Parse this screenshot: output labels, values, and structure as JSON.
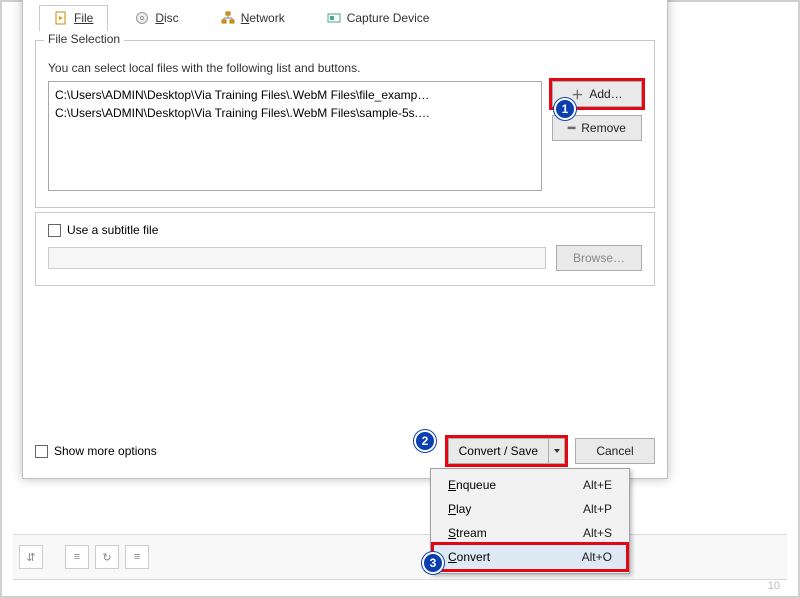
{
  "tabs": {
    "file": "File",
    "disc": "Disc",
    "network": "Network",
    "capture": "Capture Device"
  },
  "fileSelection": {
    "title": "File Selection",
    "help": "You can select local files with the following list and buttons.",
    "files": [
      "C:\\Users\\ADMIN\\Desktop\\Via Training Files\\.WebM Files\\file_examp…",
      "C:\\Users\\ADMIN\\Desktop\\Via Training Files\\.WebM Files\\sample-5s.…"
    ],
    "addLabel": "Add…",
    "removeLabel": "Remove"
  },
  "subtitle": {
    "checkboxLabel": "Use a subtitle file",
    "browseLabel": "Browse…"
  },
  "bottom": {
    "moreOptions": "Show more options",
    "convertSave": "Convert / Save",
    "cancel": "Cancel"
  },
  "menu": {
    "items": [
      {
        "label": "Enqueue",
        "ul": "E",
        "shortcut": "Alt+E"
      },
      {
        "label": "Play",
        "ul": "P",
        "shortcut": "Alt+P"
      },
      {
        "label": "Stream",
        "ul": "S",
        "shortcut": "Alt+S"
      },
      {
        "label": "Convert",
        "ul": "C",
        "shortcut": "Alt+O"
      }
    ]
  },
  "callouts": {
    "one": "1",
    "two": "2",
    "three": "3"
  },
  "pageNumber": "10",
  "colors": {
    "annotRed": "#e30613",
    "calloutBlue": "#0a3fb0"
  }
}
